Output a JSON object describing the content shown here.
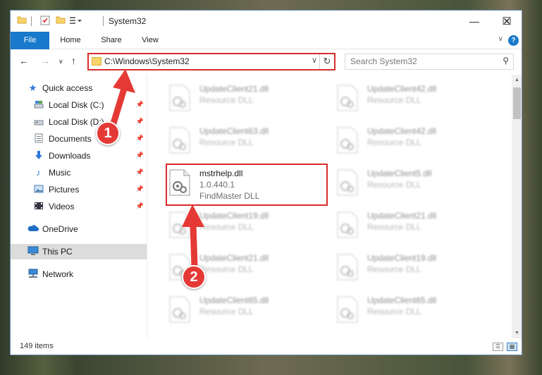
{
  "window": {
    "title": "System32",
    "controls": {
      "minimize": "—",
      "maximize": "☐",
      "close": "✕"
    }
  },
  "ribbon": {
    "tabs": [
      "File",
      "Home",
      "Share",
      "View"
    ],
    "help": "?"
  },
  "nav": {
    "address": "C:\\Windows\\System32",
    "search_placeholder": "Search System32"
  },
  "sidebar": {
    "items": [
      {
        "label": "Quick access",
        "icon": "star-icon",
        "pinned": false
      },
      {
        "label": "Local Disk (C:)",
        "icon": "drive-icon",
        "pinned": true
      },
      {
        "label": "Local Disk (D:)",
        "icon": "drive-icon",
        "pinned": true
      },
      {
        "label": "Documents",
        "icon": "documents-icon",
        "pinned": true
      },
      {
        "label": "Downloads",
        "icon": "download-icon",
        "pinned": true
      },
      {
        "label": "Music",
        "icon": "music-icon",
        "pinned": true
      },
      {
        "label": "Pictures",
        "icon": "pictures-icon",
        "pinned": true
      },
      {
        "label": "Videos",
        "icon": "videos-icon",
        "pinned": true
      },
      {
        "label": "OneDrive",
        "icon": "cloud-icon",
        "pinned": false
      },
      {
        "label": "This PC",
        "icon": "computer-icon",
        "pinned": false,
        "selected": true
      },
      {
        "label": "Network",
        "icon": "network-icon",
        "pinned": false
      }
    ]
  },
  "files": {
    "left": [
      {
        "name": "UpdateClient21.dll",
        "line1": "Resource DLL",
        "line2": ""
      },
      {
        "name": "UpdateClient63.dll",
        "line1": "Resource DLL",
        "line2": ""
      },
      {
        "name": "mstrhelp.dll",
        "line1": "1.0.440.1",
        "line2": "FindMaster DLL",
        "highlighted": true
      },
      {
        "name": "UpdateClient19.dll",
        "line1": "Resource DLL",
        "line2": ""
      },
      {
        "name": "UpdateClient21.dll",
        "line1": "Resource DLL",
        "line2": ""
      },
      {
        "name": "UpdateClient65.dll",
        "line1": "Resource DLL",
        "line2": ""
      }
    ],
    "right": [
      {
        "name": "UpdateClient42.dll",
        "line1": "Resource DLL",
        "line2": ""
      },
      {
        "name": "UpdateClient42.dll",
        "line1": "Resource DLL",
        "line2": ""
      },
      {
        "name": "UpdateClient5.dll",
        "line1": "Resource DLL",
        "line2": ""
      },
      {
        "name": "UpdateClient21.dll",
        "line1": "Resource DLL",
        "line2": ""
      },
      {
        "name": "UpdateClient19.dll",
        "line1": "Resource DLL",
        "line2": ""
      },
      {
        "name": "UpdateClient65.dll",
        "line1": "Resource DLL",
        "line2": ""
      }
    ]
  },
  "status": {
    "count": "149 items"
  },
  "annotations": {
    "step1": "1",
    "step2": "2",
    "color": "#e53935",
    "box_color": "#d92b2b"
  }
}
